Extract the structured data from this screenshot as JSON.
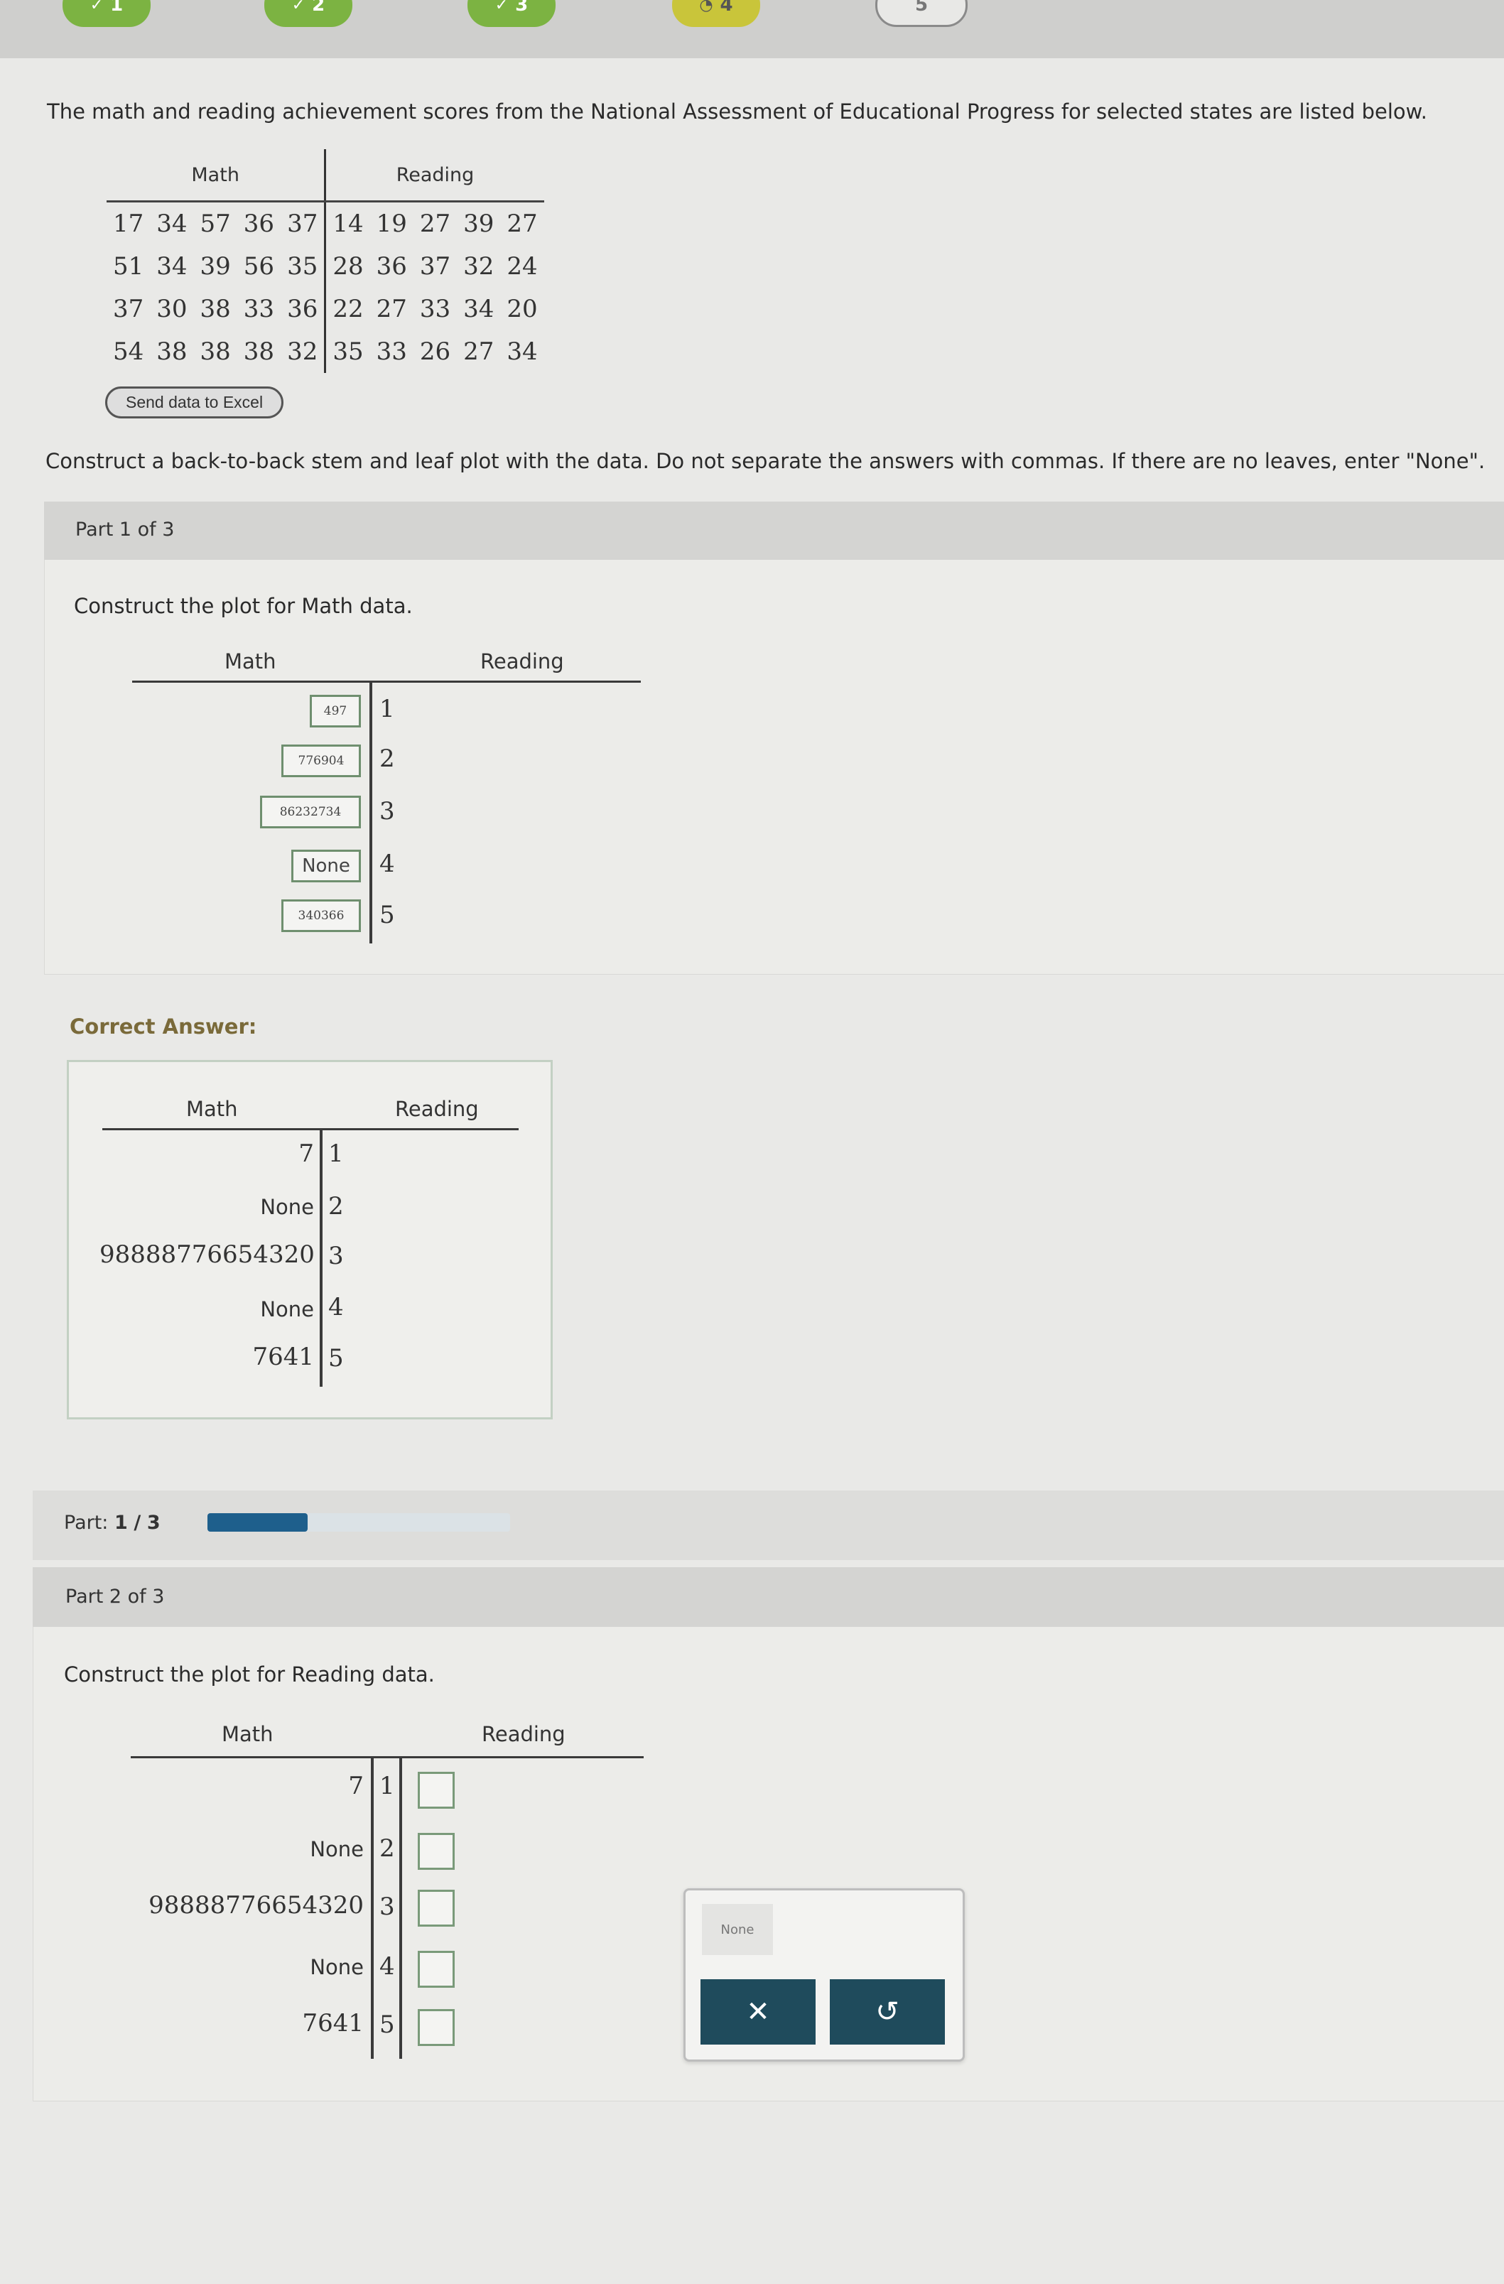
{
  "questions": [
    {
      "label": "1",
      "status": "correct"
    },
    {
      "label": "2",
      "status": "correct"
    },
    {
      "label": "3",
      "status": "correct"
    },
    {
      "label": "4",
      "status": "current"
    },
    {
      "label": "5",
      "status": "unanswered"
    }
  ],
  "problem": {
    "intro": "The math and reading achievement scores from the National Assessment of Educational Progress for selected states are listed below.",
    "table": {
      "headers": [
        "Math",
        "Reading"
      ],
      "rows": [
        {
          "math": [
            "17",
            "34",
            "57",
            "36",
            "37"
          ],
          "reading": [
            "14",
            "19",
            "27",
            "39",
            "27"
          ]
        },
        {
          "math": [
            "51",
            "34",
            "39",
            "56",
            "35"
          ],
          "reading": [
            "28",
            "36",
            "37",
            "32",
            "24"
          ]
        },
        {
          "math": [
            "37",
            "30",
            "38",
            "33",
            "36"
          ],
          "reading": [
            "22",
            "27",
            "33",
            "34",
            "20"
          ]
        },
        {
          "math": [
            "54",
            "38",
            "38",
            "38",
            "32"
          ],
          "reading": [
            "35",
            "33",
            "26",
            "27",
            "34"
          ]
        }
      ]
    },
    "excel_button": "Send data to Excel",
    "instruction": "Construct a back-to-back stem and leaf plot with the data. Do not separate the answers with commas. If there are no leaves, enter \"None\"."
  },
  "part1": {
    "header": "Part 1 of 3",
    "prompt": "Construct the plot for Math data.",
    "plot_headers": {
      "left": "Math",
      "right": "Reading"
    },
    "stems": [
      "1",
      "2",
      "3",
      "4",
      "5"
    ],
    "entered_leaves": [
      "497",
      "776904",
      "86232734",
      "None",
      "340366"
    ]
  },
  "correct": {
    "label": "Correct Answer:",
    "plot_headers": {
      "left": "Math",
      "right": "Reading"
    },
    "stems": [
      "1",
      "2",
      "3",
      "4",
      "5"
    ],
    "leaves": [
      "7",
      "None",
      "98888776654320",
      "None",
      "7641"
    ]
  },
  "progress": {
    "label": "Part:",
    "current": "1",
    "sep": "/",
    "total": "3",
    "fraction": 0.33
  },
  "part2": {
    "header": "Part 2 of 3",
    "prompt": "Construct the plot for Reading data.",
    "plot_headers": {
      "left": "Math",
      "right": "Reading"
    },
    "stems": [
      "1",
      "2",
      "3",
      "4",
      "5"
    ],
    "math_leaves": [
      "7",
      "None",
      "98888776654320",
      "None",
      "7641"
    ],
    "popup": {
      "none_chip": "None",
      "clear_glyph": "✕",
      "undo_glyph": "↺"
    }
  }
}
